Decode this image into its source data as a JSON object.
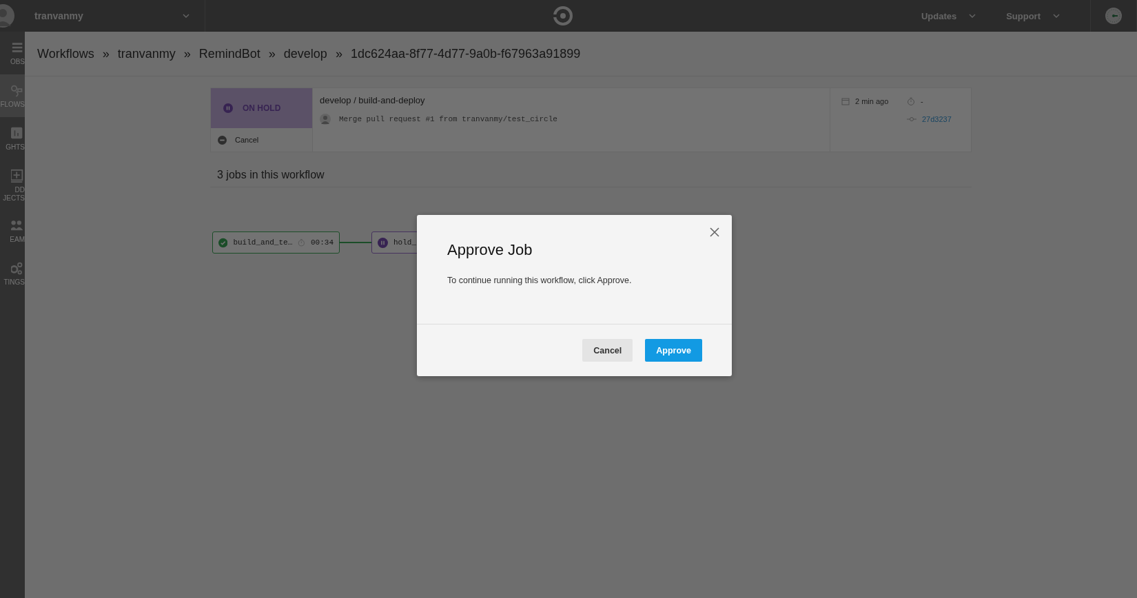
{
  "top_bar": {
    "user": "tranvanmy",
    "menus": [
      {
        "label": "Updates"
      },
      {
        "label": "Support"
      }
    ]
  },
  "sidebar": {
    "items": [
      {
        "label": "OBS",
        "selected": false
      },
      {
        "label": "FLOWS",
        "selected": true
      },
      {
        "label": "GHTS",
        "selected": false
      },
      {
        "label": "DD JECTS",
        "selected": false
      },
      {
        "label": "EAM",
        "selected": false
      },
      {
        "label": "TINGS",
        "selected": false
      }
    ]
  },
  "breadcrumb": {
    "separator": "»",
    "items": [
      "Workflows",
      "tranvanmy",
      "RemindBot",
      "develop",
      "1dc624aa-8f77-4d77-9a0b-f67963a91899"
    ]
  },
  "workflow": {
    "status": {
      "label": "ON HOLD",
      "kind": "on_hold"
    },
    "cancel_label": "Cancel",
    "title": "develop / build-and-deploy",
    "commit_message": "Merge pull request #1 from tranvanmy/test_circle",
    "time": "2 min ago",
    "duration": "-",
    "commit": "27d3237"
  },
  "jobs_heading": "3 jobs in this workflow",
  "jobs": [
    {
      "name": "build_and_te…",
      "kind": "success",
      "duration": "00:34"
    },
    {
      "name": "hold_",
      "kind": "on_hold"
    }
  ],
  "modal": {
    "title": "Approve Job",
    "message": "To continue running this workflow, click Approve.",
    "buttons": [
      {
        "label": "Cancel",
        "kind": "secondary"
      },
      {
        "label": "Approve",
        "kind": "primary"
      }
    ]
  }
}
